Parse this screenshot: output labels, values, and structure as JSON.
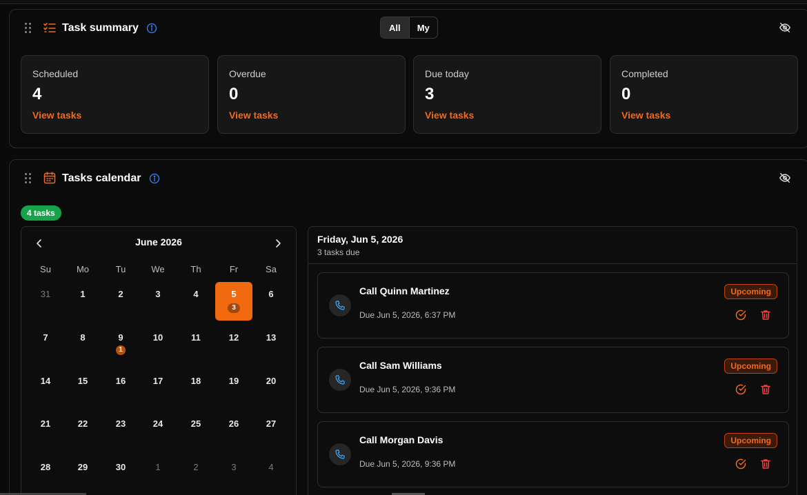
{
  "summary": {
    "title": "Task summary",
    "toggle": {
      "all": "All",
      "my": "My",
      "active": "All"
    },
    "cards": [
      {
        "label": "Scheduled",
        "value": "4",
        "link": "View tasks"
      },
      {
        "label": "Overdue",
        "value": "0",
        "link": "View tasks"
      },
      {
        "label": "Due today",
        "value": "3",
        "link": "View tasks"
      },
      {
        "label": "Completed",
        "value": "0",
        "link": "View tasks"
      }
    ]
  },
  "calendar": {
    "title": "Tasks calendar",
    "badge": "4 tasks",
    "month": "June 2026",
    "weekdays": [
      "Su",
      "Mo",
      "Tu",
      "We",
      "Th",
      "Fr",
      "Sa"
    ],
    "weeks": [
      [
        "31",
        "1",
        "2",
        "3",
        "4",
        "5",
        "6"
      ],
      [
        "7",
        "8",
        "9",
        "10",
        "11",
        "12",
        "13"
      ],
      [
        "14",
        "15",
        "16",
        "17",
        "18",
        "19",
        "20"
      ],
      [
        "21",
        "22",
        "23",
        "24",
        "25",
        "26",
        "27"
      ],
      [
        "28",
        "29",
        "30",
        "1",
        "2",
        "3",
        "4"
      ]
    ],
    "selected_day_count": "3",
    "day9_count": "1"
  },
  "tasks": {
    "date": "Friday, Jun 5, 2026",
    "subtitle": "3 tasks due",
    "items": [
      {
        "title": "Call Quinn Martinez",
        "due": "Due Jun 5, 2026, 6:37 PM",
        "status": "Upcoming"
      },
      {
        "title": "Call Sam Williams",
        "due": "Due Jun 5, 2026, 9:36 PM",
        "status": "Upcoming"
      },
      {
        "title": "Call Morgan Davis",
        "due": "Due Jun 5, 2026, 9:36 PM",
        "status": "Upcoming"
      }
    ]
  },
  "colors": {
    "accent": "#f26a1b",
    "success": "#16a34a",
    "info": "#3b82f6",
    "danger": "#ef4444"
  }
}
